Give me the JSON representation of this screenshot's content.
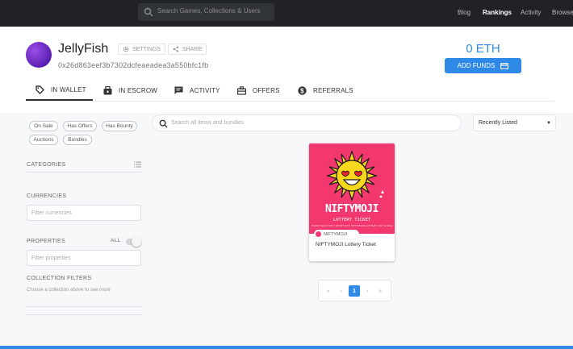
{
  "topbar": {
    "search_placeholder": "Search Games, Collections & Users",
    "nav": [
      "Blog",
      "Rankings",
      "Activity",
      "Browse"
    ],
    "active_nav": "Rankings"
  },
  "profile": {
    "username": "JellyFish",
    "settings_label": "SETTINGS",
    "share_label": "SHARE",
    "address": "0x26d863eef3b7302dcfeaeadea3a550bfc1fb",
    "balance": "0 ETH",
    "add_funds_label": "ADD FUNDS"
  },
  "tabs": [
    {
      "label": "IN WALLET",
      "icon": "tag-icon"
    },
    {
      "label": "IN ESCROW",
      "icon": "escrow-icon"
    },
    {
      "label": "ACTIVITY",
      "icon": "chat-icon"
    },
    {
      "label": "OFFERS",
      "icon": "offers-icon"
    },
    {
      "label": "REFERRALS",
      "icon": "dollar-icon"
    }
  ],
  "active_tab": "IN WALLET",
  "sidebar": {
    "filters": [
      "On Sale",
      "Has Offers",
      "Has Bounty",
      "Auctions",
      "Bundles"
    ],
    "categories_title": "CATEGORIES",
    "currencies_title": "CURRENCIES",
    "currencies_placeholder": "Filter currencies",
    "properties_title": "PROPERTIES",
    "properties_toggle_label": "ALL",
    "properties_placeholder": "Filter properties",
    "collection_filters_title": "COLLECTION FILTERS",
    "collection_filters_hint": "Choose a collection above to see more"
  },
  "main": {
    "search_placeholder": "Search all items and bundles",
    "sort_value": "Recently Listed",
    "item": {
      "art_title": "NIFTYMOJI",
      "art_subtitle": "LOTTERY TICKET",
      "art_fine": "TICKET VALID FOR 1 ENTRY INTO NIFTYMOJIS LOTTERY, MAY 31 2022",
      "collection": "NIFTYMOJI",
      "name": "NIFTYMOJI Lottery Ticket"
    },
    "pagination": {
      "first": "«",
      "prev": "‹",
      "current": "1",
      "next": "›",
      "last": "»"
    }
  },
  "colors": {
    "accent": "#2f89e6",
    "topbar": "#202225",
    "card_bg": "#f3386f",
    "sun": "#f9d71c"
  }
}
